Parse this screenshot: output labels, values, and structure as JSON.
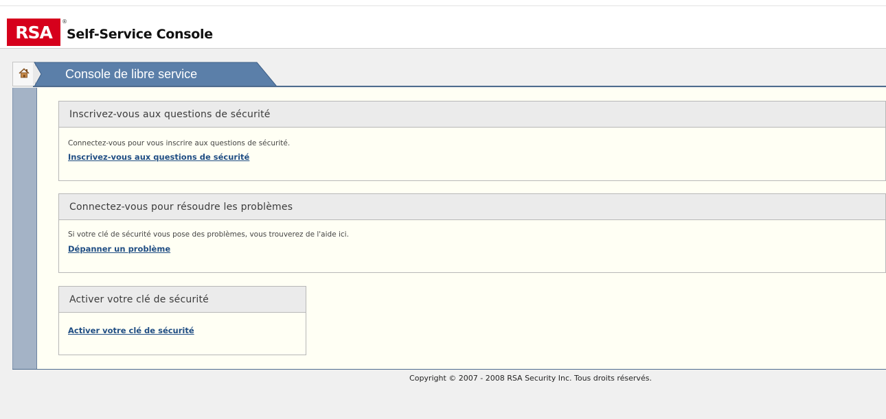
{
  "brand": {
    "logo_text": "RSA",
    "reg_mark": "®",
    "app_title": "Self-Service Console"
  },
  "nav": {
    "home_icon": "home-icon",
    "tab_label": "Console de libre service"
  },
  "sections": [
    {
      "title": "Inscrivez-vous aux questions de sécurité",
      "description": "Connectez-vous pour vous inscrire aux questions de sécurité.",
      "link": "Inscrivez-vous aux questions de sécurité"
    },
    {
      "title": "Connectez-vous pour résoudre les problèmes",
      "description": "Si votre clé de sécurité vous pose des problèmes, vous trouverez de l'aide ici.",
      "link": "Dépanner un problème"
    },
    {
      "title": "Activer votre clé de sécurité",
      "link": "Activer votre clé de sécurité"
    }
  ],
  "footer": {
    "copyright": "Copyright © 2007 - 2008 RSA Security Inc. Tous droits réservés."
  },
  "colors": {
    "brand_red": "#d6001c",
    "tab_blue": "#5b7fa9",
    "link_blue": "#1f4d83",
    "content_bg": "#fffff4"
  }
}
